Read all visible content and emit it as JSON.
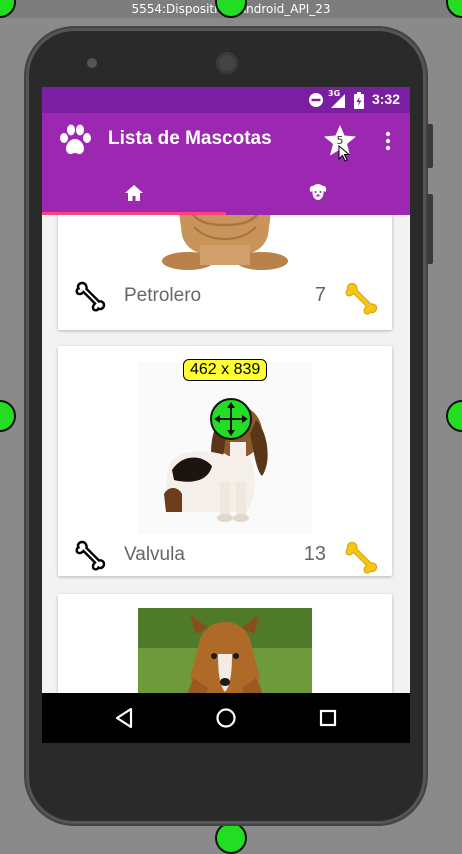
{
  "window": {
    "title": "5554:Dispositivo_Android_API_23"
  },
  "status_bar": {
    "time": "3:32",
    "signal_label": "3G"
  },
  "app_bar": {
    "title": "Lista de Mascotas",
    "favorites_count": "5",
    "icons": {
      "logo": "paw-icon",
      "favorites": "star-icon",
      "menu": "more-vert-icon"
    }
  },
  "tabs": [
    {
      "icon": "home-icon",
      "selected": true
    },
    {
      "icon": "dog-face-icon",
      "selected": false
    }
  ],
  "pets": [
    {
      "name": "Petrolero",
      "likes": "7"
    },
    {
      "name": "Valvula",
      "likes": "13"
    },
    {
      "name": "",
      "likes": ""
    }
  ],
  "overlay": {
    "size_label": "462 x 839"
  },
  "colors": {
    "primary": "#9c27b0",
    "primary_dark": "#7b1fa2",
    "accent": "#ff4081",
    "bone_gold": "#f5c518"
  }
}
